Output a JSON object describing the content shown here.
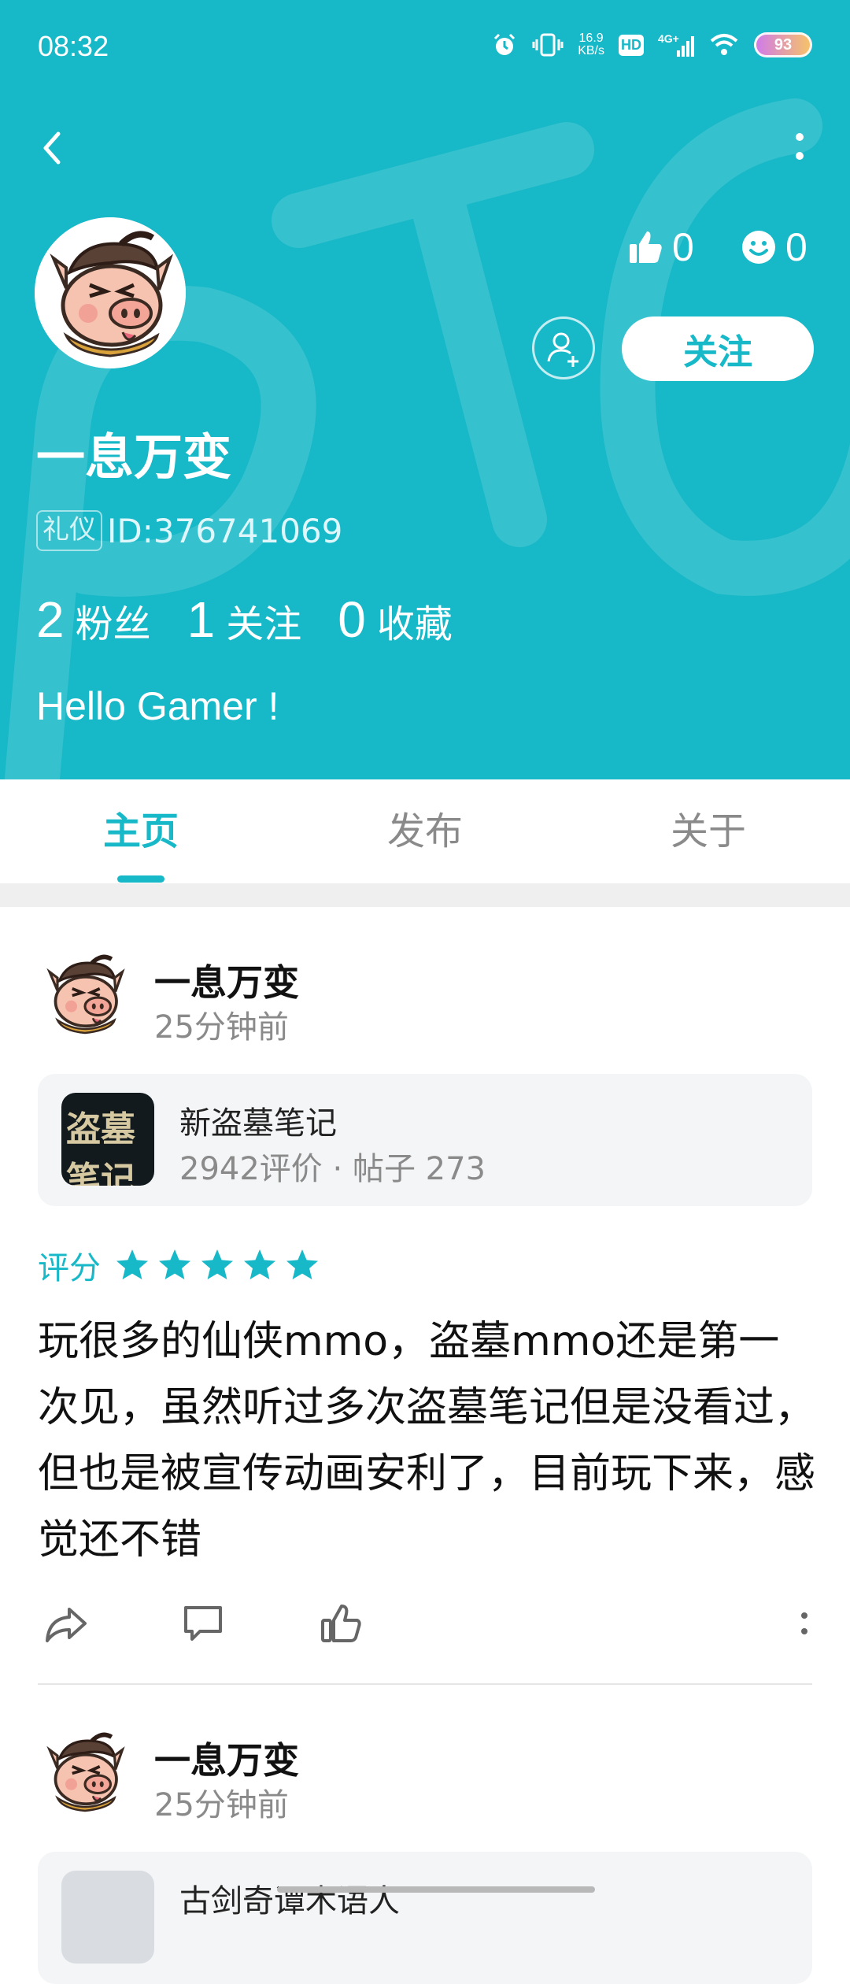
{
  "status_bar": {
    "time": "08:32",
    "speed": "16.9",
    "speed_unit": "KB/s",
    "hd": "HD",
    "network": "4G+",
    "battery": "93"
  },
  "profile": {
    "name": "一息万变",
    "badge": "礼仪",
    "id_text": "ID:376741069",
    "likes": "0",
    "smiles": "0",
    "follow_label": "关注",
    "stats": [
      {
        "num": "2",
        "label": "粉丝"
      },
      {
        "num": "1",
        "label": "关注"
      },
      {
        "num": "0",
        "label": "收藏"
      }
    ],
    "bio": "Hello Gamer !"
  },
  "tabs": [
    {
      "label": "主页",
      "active": true
    },
    {
      "label": "发布",
      "active": false
    },
    {
      "label": "关于",
      "active": false
    }
  ],
  "posts": [
    {
      "author": "一息万变",
      "time": "25分钟前",
      "game": {
        "icon_text": "盗墓笔记",
        "title": "新盗墓笔记",
        "meta": "2942评价 · 帖子 273"
      },
      "rating_label": "评分",
      "rating": 5,
      "text": "玩很多的仙侠mmo，盗墓mmo还是第一次见，虽然听过多次盗墓笔记但是没看过，但也是被宣传动画安利了，目前玩下来，感觉还不错"
    },
    {
      "author": "一息万变",
      "time": "25分钟前",
      "game": {
        "title": "古剑奇谭木语人"
      }
    }
  ],
  "colors": {
    "accent": "#17b8c7",
    "header_bg": "#17b8c7",
    "muted": "#8a8a8a"
  },
  "icons": {
    "back": "back-arrow-icon",
    "more": "more-vertical-icon",
    "like": "thumbs-up-icon",
    "smile": "smile-icon",
    "add_friend": "add-friend-icon",
    "share": "share-icon",
    "comment": "comment-icon",
    "star": "star-icon"
  }
}
